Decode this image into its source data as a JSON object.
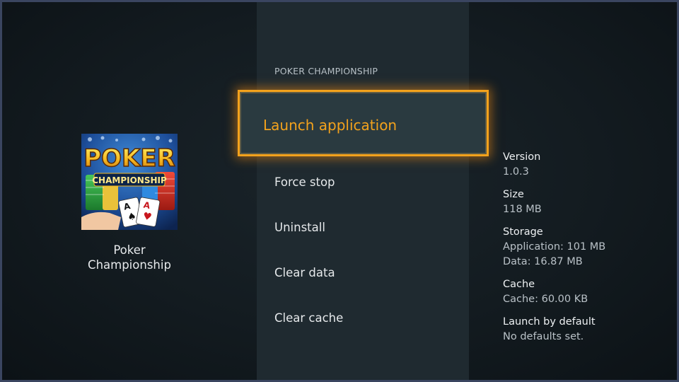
{
  "app": {
    "title_header": "POKER CHAMPIONSHIP",
    "name_line1": "Poker",
    "name_line2": "Championship",
    "icon": {
      "name": "poker-championship-app-icon",
      "logo_line1": "POKER",
      "logo_line2": "CHAMPIONSHIP"
    }
  },
  "menu": {
    "focused": "Launch application",
    "items": [
      "Force stop",
      "Uninstall",
      "Clear data",
      "Clear cache"
    ]
  },
  "info": {
    "version_label": "Version",
    "version": "1.0.3",
    "size_label": "Size",
    "size": "118 MB",
    "storage_label": "Storage",
    "storage_app": "Application: 101 MB",
    "storage_data": "Data: 16.87 MB",
    "cache_label": "Cache",
    "cache": "Cache: 60.00 KB",
    "default_label": "Launch by default",
    "default": "No defaults set."
  },
  "colors": {
    "accent": "#f3a21c",
    "panel": "#1f2a30",
    "text": "#e6e9eb"
  }
}
